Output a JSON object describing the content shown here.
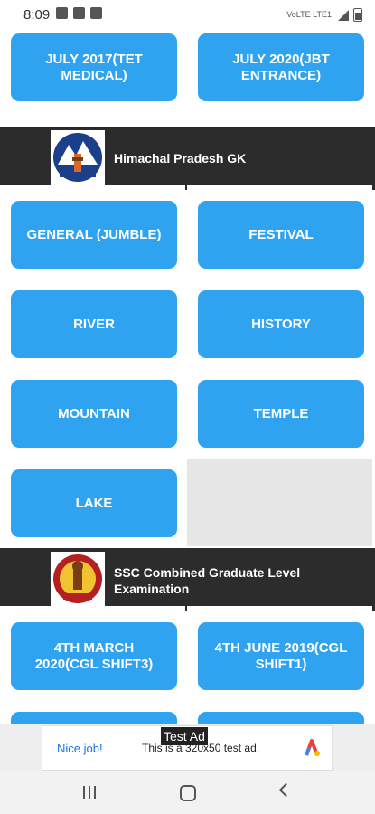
{
  "status_bar": {
    "time": "8:09",
    "network": "VoLTE LTE1"
  },
  "sections": [
    {
      "buttons": [
        "JULY 2017(TET MEDICAL)",
        "JULY 2020(JBT ENTRANCE)"
      ]
    },
    {
      "header": "Himachal Pradesh GK",
      "buttons": [
        "GENERAL (JUMBLE)",
        "FESTIVAL",
        "RIVER",
        "HISTORY",
        "MOUNTAIN",
        "TEMPLE",
        "LAKE"
      ]
    },
    {
      "header": "SSC Combined Graduate Level Examination",
      "buttons": [
        "4TH MARCH 2020(CGL SHIFT3)",
        "4TH JUNE 2019(CGL SHIFT1)"
      ]
    }
  ],
  "ad": {
    "label": "Test Ad",
    "nice": "Nice job!",
    "text": "This is a 320x50 test ad."
  },
  "colors": {
    "button": "#2fa3f0",
    "header_band": "#2c2c2c"
  }
}
